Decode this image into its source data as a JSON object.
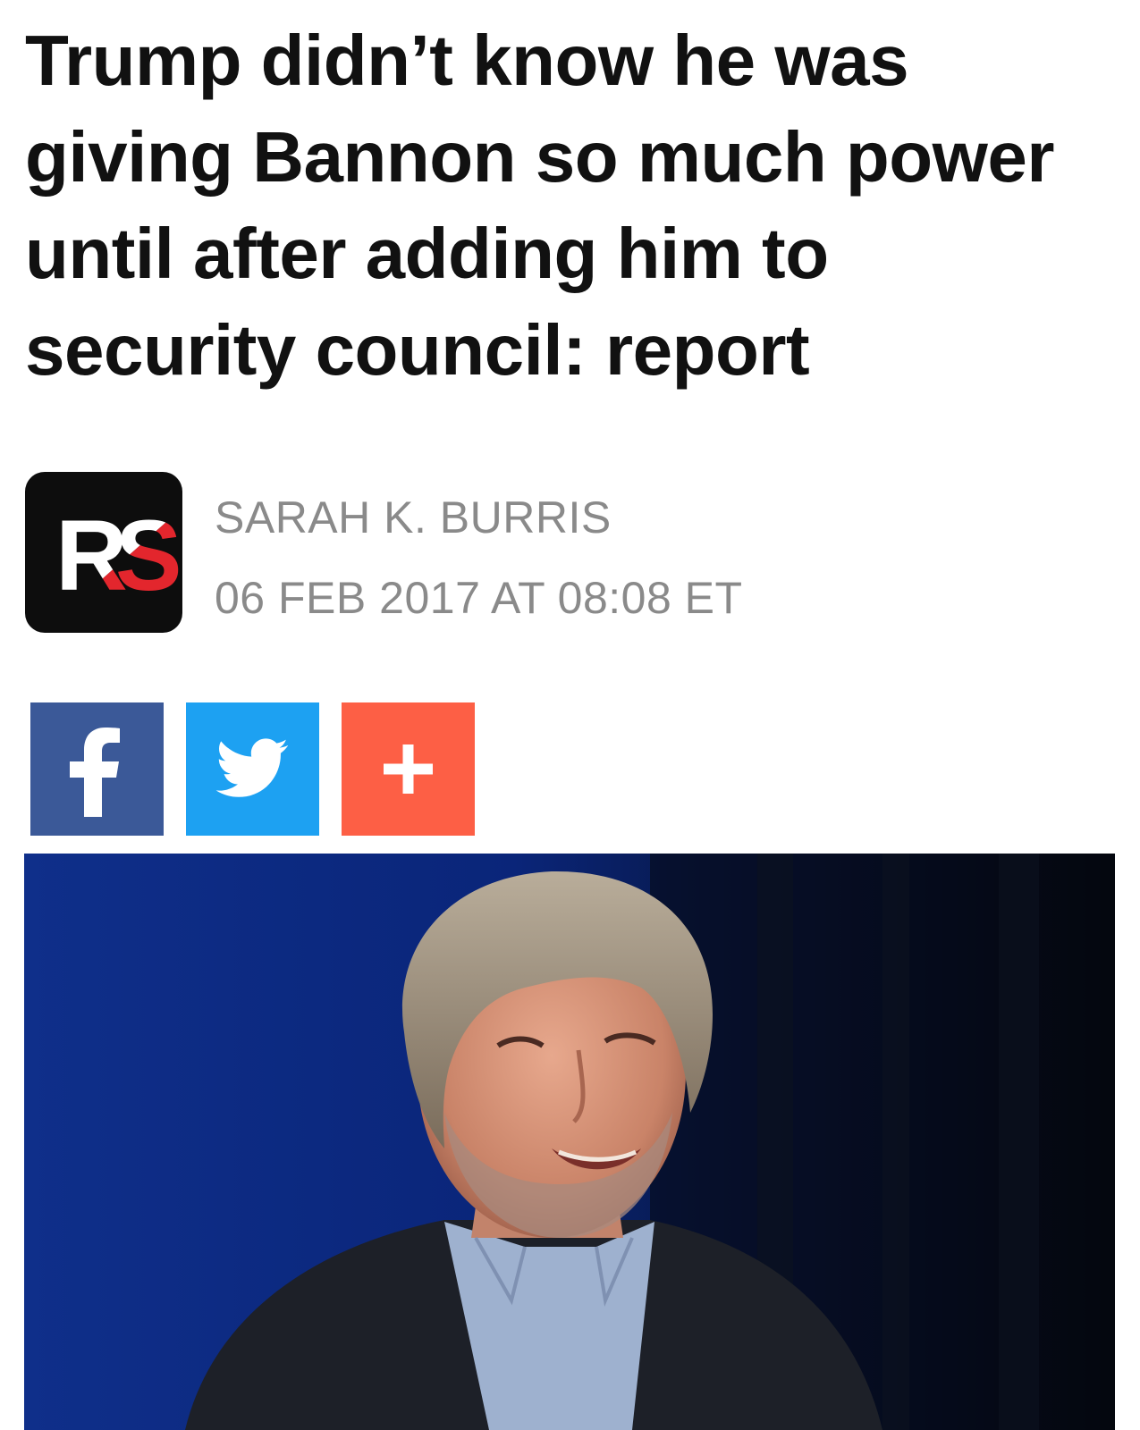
{
  "article": {
    "headline": "Trump didn’t know he was giving Bannon so much power until after adding him to security council: report",
    "author": "SARAH K. BURRIS",
    "timestamp": "06 FEB 2017 AT 08:08 ET"
  },
  "publisher_logo": {
    "text": "RS",
    "icon": "rs-logo-icon"
  },
  "share": {
    "buttons": [
      {
        "network": "facebook",
        "icon": "facebook-icon",
        "color": "#3b5998"
      },
      {
        "network": "twitter",
        "icon": "twitter-bird-icon",
        "color": "#1da1f2"
      },
      {
        "network": "more",
        "icon": "plus-icon",
        "color": "#fd5f45"
      }
    ]
  },
  "colors": {
    "headline": "#111111",
    "meta": "#8a8a8a",
    "logo_bg": "#0d0d0d",
    "logo_accent": "#e3262d"
  }
}
